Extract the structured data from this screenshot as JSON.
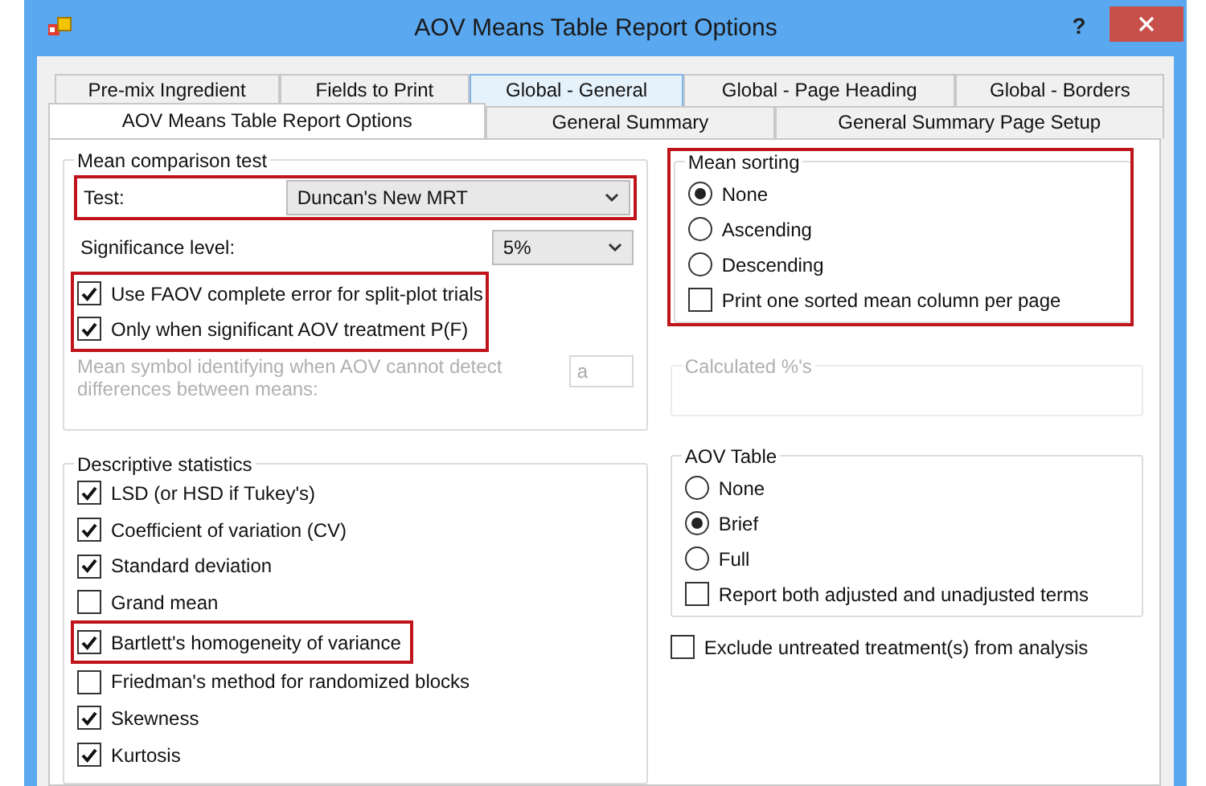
{
  "window": {
    "title": "AOV Means Table Report Options",
    "help": "?"
  },
  "tabs": [
    [
      {
        "label": "Pre-mix Ingredient",
        "selected": false,
        "hovered": false
      },
      {
        "label": "Fields to Print",
        "selected": false,
        "hovered": false
      },
      {
        "label": "Global - General",
        "selected": false,
        "hovered": true
      },
      {
        "label": "Global - Page Heading",
        "selected": false,
        "hovered": false
      },
      {
        "label": "Global - Borders",
        "selected": false,
        "hovered": false
      }
    ],
    [
      {
        "label": "AOV Means Table Report Options",
        "selected": true,
        "hovered": false
      },
      {
        "label": "General Summary",
        "selected": false,
        "hovered": false
      },
      {
        "label": "General Summary Page Setup",
        "selected": false,
        "hovered": false
      }
    ]
  ],
  "mean_comparison": {
    "title": "Mean comparison test",
    "test": {
      "label": "Test:",
      "value": "Duncan's New MRT",
      "highlighted": true
    },
    "significance": {
      "label": "Significance level:",
      "value": "5%"
    },
    "options": {
      "highlighted": true,
      "items": [
        {
          "label": "Use FAOV complete error for split-plot trials",
          "checked": true
        },
        {
          "label": "Only when significant AOV treatment P(F)",
          "checked": true
        }
      ]
    },
    "mean_symbol": {
      "label": "Mean symbol identifying when AOV cannot detect differences between means:",
      "value": "a",
      "disabled": true
    }
  },
  "descriptive": {
    "title": "Descriptive statistics",
    "items": [
      {
        "label": "LSD (or HSD if Tukey's)",
        "checked": true,
        "highlighted": false
      },
      {
        "label": "Coefficient of variation (CV)",
        "checked": true,
        "highlighted": false
      },
      {
        "label": "Standard deviation",
        "checked": true,
        "highlighted": false
      },
      {
        "label": "Grand mean",
        "checked": false,
        "highlighted": false
      },
      {
        "label": "Bartlett's homogeneity of variance",
        "checked": true,
        "highlighted": true
      },
      {
        "label": "Friedman's method for randomized blocks",
        "checked": false,
        "highlighted": false
      },
      {
        "label": "Skewness",
        "checked": true,
        "highlighted": false
      },
      {
        "label": "Kurtosis",
        "checked": true,
        "highlighted": false
      }
    ]
  },
  "mean_sorting": {
    "title": "Mean sorting",
    "highlighted": true,
    "options": [
      {
        "label": "None",
        "selected": true
      },
      {
        "label": "Ascending",
        "selected": false
      },
      {
        "label": "Descending",
        "selected": false
      }
    ],
    "print_one": {
      "label": "Print one sorted mean column per page",
      "checked": false
    }
  },
  "calculated": {
    "title": "Calculated %'s",
    "disabled": true
  },
  "aov_table": {
    "title": "AOV Table",
    "options": [
      {
        "label": "None",
        "selected": false
      },
      {
        "label": "Brief",
        "selected": true
      },
      {
        "label": "Full",
        "selected": false
      }
    ],
    "report_both": {
      "label": "Report both adjusted and unadjusted terms",
      "checked": false
    }
  },
  "exclude": {
    "label": "Exclude untreated treatment(s) from analysis",
    "checked": false
  }
}
